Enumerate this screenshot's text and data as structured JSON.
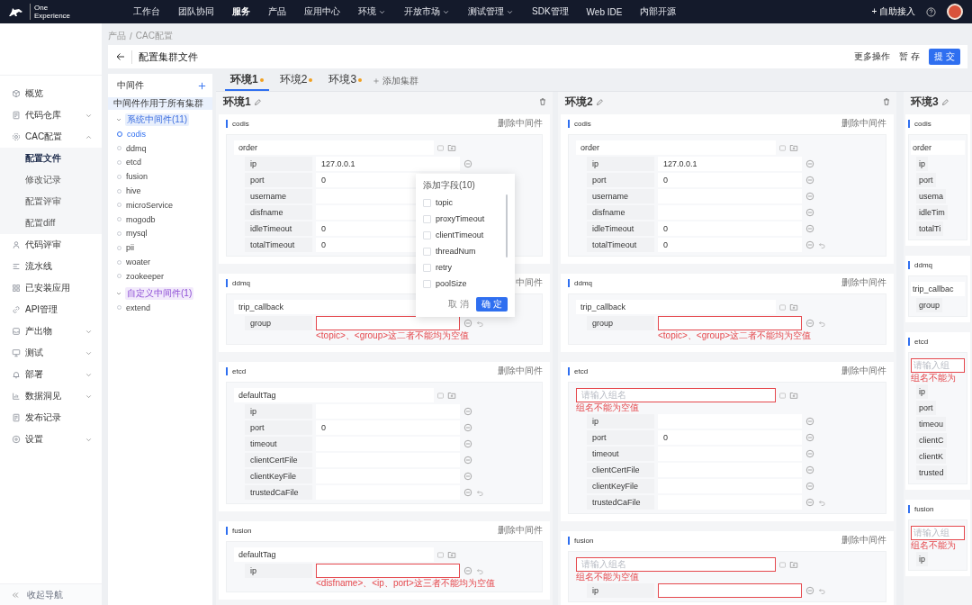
{
  "topbar": {
    "logo_lines": [
      "One",
      "Experience"
    ],
    "nav": [
      {
        "label": "工作台",
        "selected": false,
        "dropdown": false
      },
      {
        "label": "团队协同",
        "selected": false,
        "dropdown": false
      },
      {
        "label": "服务",
        "selected": true,
        "dropdown": false
      },
      {
        "label": "产品",
        "selected": false,
        "dropdown": false
      },
      {
        "label": "应用中心",
        "selected": false,
        "dropdown": false
      },
      {
        "label": "环境",
        "selected": false,
        "dropdown": true
      },
      {
        "label": "开放市场",
        "selected": false,
        "dropdown": true
      },
      {
        "label": "测试管理",
        "selected": false,
        "dropdown": true
      },
      {
        "label": "SDK管理",
        "selected": false,
        "dropdown": false
      },
      {
        "label": "Web IDE",
        "selected": false,
        "dropdown": false
      },
      {
        "label": "内部开源",
        "selected": false,
        "dropdown": false
      }
    ],
    "self_service": "+ 自助接入"
  },
  "sidebar": {
    "items": [
      {
        "label": "概览"
      },
      {
        "label": "代码仓库",
        "expanded": false
      },
      {
        "label": "CAC配置",
        "expanded": true,
        "children": [
          {
            "label": "配置文件",
            "selected": true
          },
          {
            "label": "修改记录",
            "selected": false
          },
          {
            "label": "配置评审",
            "selected": false
          },
          {
            "label": "配置diff",
            "selected": false
          }
        ]
      },
      {
        "label": "代码评审"
      },
      {
        "label": "流水线"
      },
      {
        "label": "已安装应用"
      },
      {
        "label": "API管理"
      },
      {
        "label": "产出物",
        "expanded": false
      },
      {
        "label": "测试",
        "expanded": false
      },
      {
        "label": "部署",
        "expanded": false
      },
      {
        "label": "数据洞见",
        "expanded": false
      },
      {
        "label": "发布记录"
      },
      {
        "label": "设置",
        "expanded": false
      }
    ],
    "collapse": "收起导航"
  },
  "breadcrumb": {
    "items": [
      "产品",
      "CAC配置"
    ],
    "separator": "/"
  },
  "header": {
    "title": "配置集群文件",
    "actions": [
      {
        "label": "更多操作",
        "kind": "text"
      },
      {
        "label": "暂 存",
        "kind": "text"
      },
      {
        "label": "提 交",
        "kind": "primary"
      }
    ]
  },
  "middleware": {
    "title": "中间件",
    "notice": "中间件作用于所有集群",
    "groups": [
      {
        "label": "系统中间件(11)",
        "expanded": true,
        "kind": "system",
        "children": [
          {
            "label": "codis",
            "selected": true
          },
          {
            "label": "ddmq",
            "selected": false
          },
          {
            "label": "etcd",
            "selected": false
          },
          {
            "label": "fusion",
            "selected": false
          },
          {
            "label": "hive",
            "selected": false
          },
          {
            "label": "microService",
            "selected": false
          },
          {
            "label": "mogodb",
            "selected": false
          },
          {
            "label": "mysql",
            "selected": false
          },
          {
            "label": "pii",
            "selected": false
          },
          {
            "label": "woater",
            "selected": false
          },
          {
            "label": "zookeeper",
            "selected": false
          }
        ]
      },
      {
        "label": "自定义中间件(1)",
        "expanded": true,
        "kind": "custom",
        "children": [
          {
            "label": "extend",
            "selected": false
          }
        ]
      }
    ]
  },
  "tabs": [
    {
      "label": "环境1",
      "selected": true,
      "modified": true
    },
    {
      "label": "环境2",
      "selected": false,
      "modified": true
    },
    {
      "label": "环境3",
      "selected": false,
      "modified": true
    }
  ],
  "add_tab": "添加集群",
  "environments": [
    {
      "name": "环境1",
      "deletable": true,
      "cropped": false,
      "sections": [
        {
          "name": "codis",
          "delete": "删除中间件",
          "groups": [
            {
              "name": "order",
              "fields": [
                {
                  "label": "ip",
                  "value": "127.0.0.1",
                  "invalid": false
                },
                {
                  "label": "port",
                  "value": "0",
                  "invalid": false
                },
                {
                  "label": "username",
                  "invalid": false
                },
                {
                  "label": "disfname",
                  "invalid": false
                },
                {
                  "label": "idleTimeout",
                  "value": "0",
                  "invalid": false
                },
                {
                  "label": "totalTimeout",
                  "value": "0",
                  "invalid": false
                }
              ]
            }
          ]
        },
        {
          "name": "ddmq",
          "delete": "中间件",
          "groups": [
            {
              "name": "trip_callback",
              "fields": [
                {
                  "label": "group",
                  "invalid": true,
                  "error": "<topic>、<group>这二者不能均为空值"
                }
              ]
            }
          ]
        },
        {
          "name": "etcd",
          "delete": "删除中间件",
          "groups": [
            {
              "name": "defaultTag",
              "fields": [
                {
                  "label": "ip",
                  "invalid": false
                },
                {
                  "label": "port",
                  "value": "0",
                  "invalid": false
                },
                {
                  "label": "timeout",
                  "invalid": false
                },
                {
                  "label": "clientCertFile",
                  "invalid": false
                },
                {
                  "label": "clientKeyFile",
                  "invalid": false
                },
                {
                  "label": "trustedCaFile",
                  "invalid": false
                }
              ]
            }
          ]
        },
        {
          "name": "fusion",
          "delete": "删除中间件",
          "groups": [
            {
              "name": "defaultTag",
              "fields": [
                {
                  "label": "ip",
                  "invalid": true,
                  "error": "<disfname>、<ip、port>这三者不能均为空值"
                }
              ]
            }
          ]
        }
      ]
    },
    {
      "name": "环境2",
      "deletable": true,
      "cropped": false,
      "sections": [
        {
          "name": "codis",
          "delete": "删除中间件",
          "groups": [
            {
              "name": "order",
              "fields": [
                {
                  "label": "ip",
                  "value": "127.0.0.1",
                  "invalid": false
                },
                {
                  "label": "port",
                  "value": "0",
                  "invalid": false
                },
                {
                  "label": "username",
                  "invalid": false
                },
                {
                  "label": "disfname",
                  "invalid": false
                },
                {
                  "label": "idleTimeout",
                  "value": "0",
                  "invalid": false
                },
                {
                  "label": "totalTimeout",
                  "value": "0",
                  "invalid": false
                }
              ]
            }
          ]
        },
        {
          "name": "ddmq",
          "delete": "删除中间件",
          "groups": [
            {
              "name": "trip_callback",
              "fields": [
                {
                  "label": "group",
                  "invalid": true,
                  "error": "<topic>、<group>这二者不能均为空值"
                }
              ]
            }
          ]
        },
        {
          "name": "etcd",
          "delete": "删除中间件",
          "groups": [
            {
              "placeholder": "请输入组名",
              "invalid": true,
              "error": "组名不能为空值",
              "fields": [
                {
                  "label": "ip",
                  "invalid": false
                },
                {
                  "label": "port",
                  "value": "0",
                  "invalid": false
                },
                {
                  "label": "timeout",
                  "invalid": false
                },
                {
                  "label": "clientCertFile",
                  "invalid": false
                },
                {
                  "label": "clientKeyFile",
                  "invalid": false
                },
                {
                  "label": "trustedCaFile",
                  "invalid": false
                }
              ]
            }
          ]
        },
        {
          "name": "fusion",
          "delete": "删除中间件",
          "groups": [
            {
              "placeholder": "请输入组名",
              "invalid": true,
              "error": "组名不能为空值",
              "fields": [
                {
                  "label": "ip",
                  "invalid": true
                }
              ]
            }
          ]
        }
      ]
    },
    {
      "name": "环境3",
      "deletable": false,
      "cropped": true,
      "sections": [
        {
          "name": "codis",
          "groups": [
            {
              "name": "order",
              "fields": [
                {
                  "label": "ip"
                },
                {
                  "label": "port"
                },
                {
                  "label": "usema"
                },
                {
                  "label": "idleTim"
                },
                {
                  "label": "totalTi"
                }
              ]
            }
          ]
        },
        {
          "name": "ddmq",
          "groups": [
            {
              "name": "trip_callbac",
              "fields": [
                {
                  "label": "group"
                }
              ]
            }
          ]
        },
        {
          "name": "etcd",
          "groups": [
            {
              "placeholder": "请输入组",
              "invalid": true,
              "error": "组名不能为",
              "fields": [
                {
                  "label": "ip"
                },
                {
                  "label": "port"
                },
                {
                  "label": "timeou"
                },
                {
                  "label": "clientC"
                },
                {
                  "label": "clientK"
                },
                {
                  "label": "trusted"
                }
              ]
            }
          ]
        },
        {
          "name": "fusion",
          "groups": [
            {
              "placeholder": "请输入组",
              "invalid": true,
              "error": "组名不能为",
              "fields": [
                {
                  "label": "ip"
                }
              ]
            }
          ]
        }
      ]
    }
  ],
  "popup": {
    "title": "添加字段(10)",
    "options": [
      {
        "label": "topic",
        "checked": false
      },
      {
        "label": "proxyTimeout",
        "checked": false
      },
      {
        "label": "clientTimeout",
        "checked": false
      },
      {
        "label": "threadNum",
        "checked": false
      },
      {
        "label": "retry",
        "checked": false
      },
      {
        "label": "poolSize",
        "checked": false
      }
    ],
    "cancel": "取 消",
    "confirm": "确 定"
  }
}
